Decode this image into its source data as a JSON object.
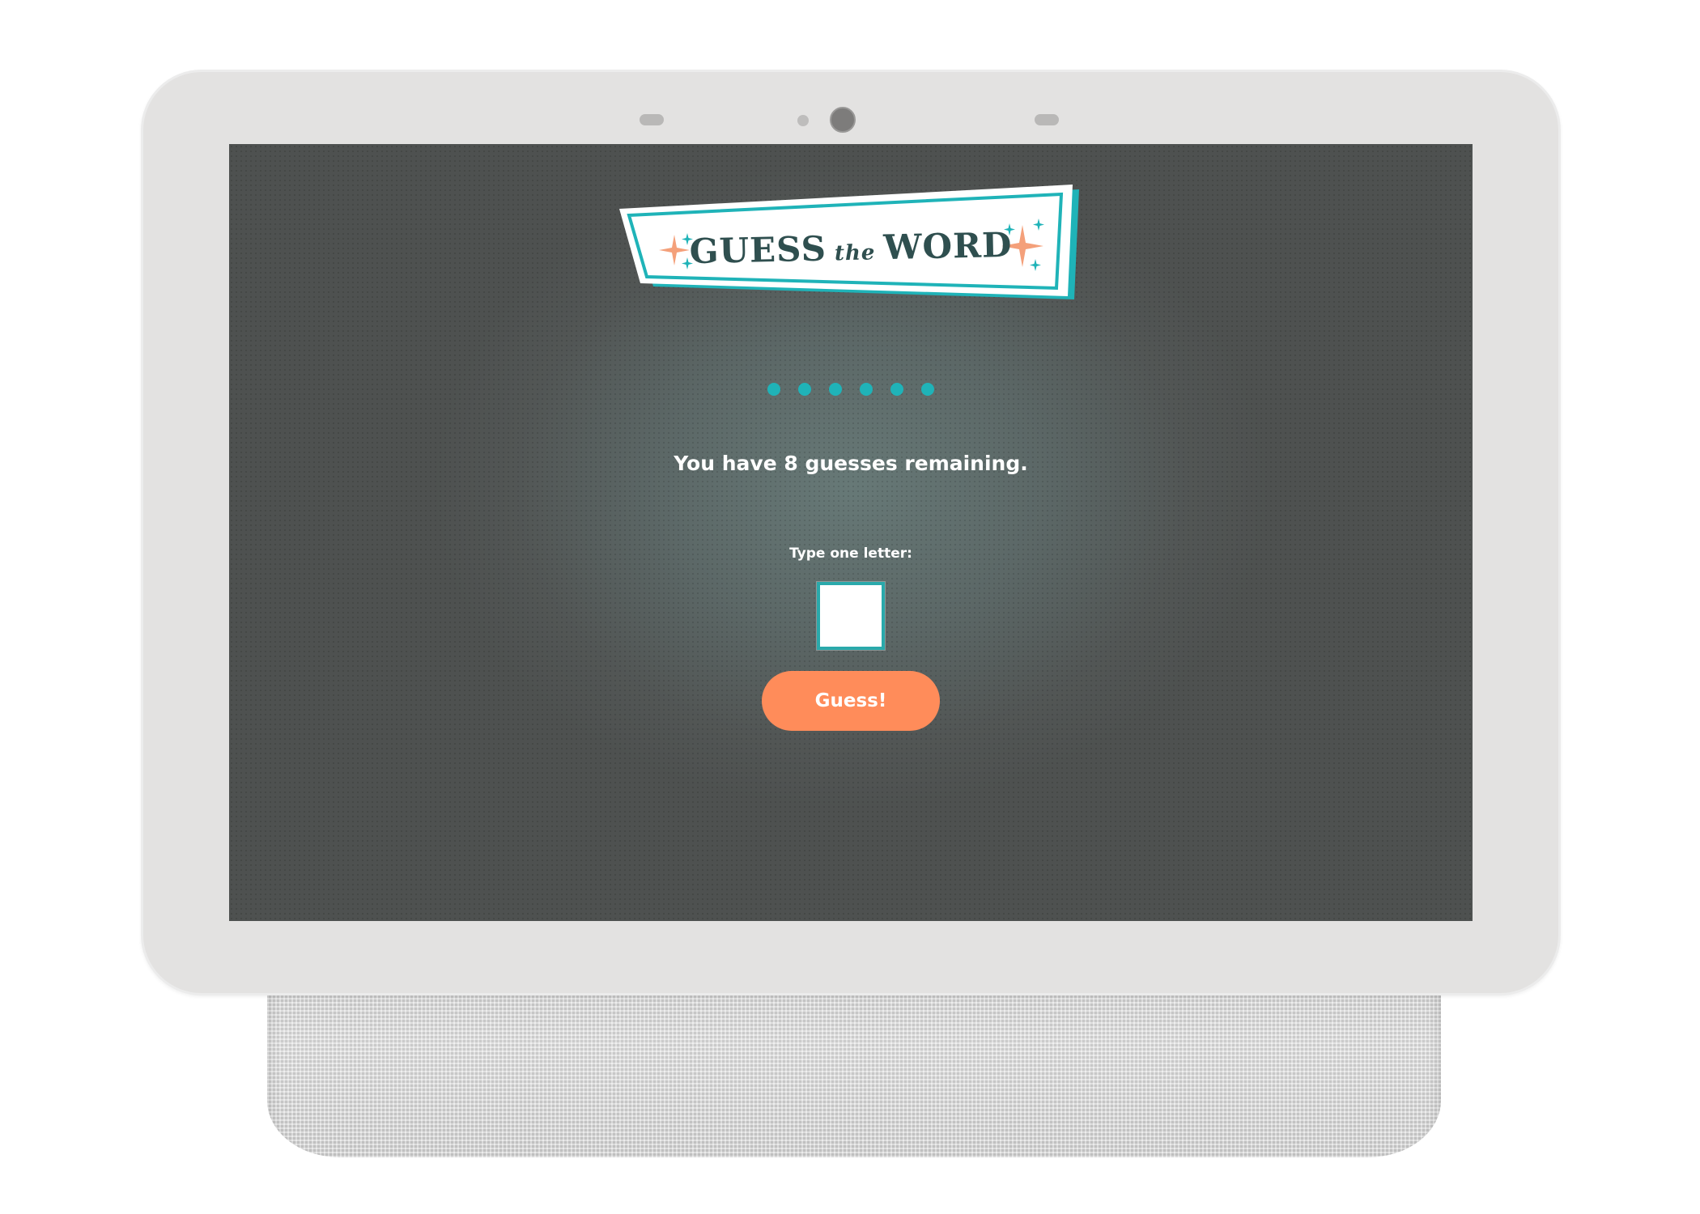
{
  "game": {
    "logo": {
      "word1": "GUESS",
      "word2": "the",
      "word3": "WORD"
    },
    "hidden_letter_count": 6,
    "status_text": "You have 8 guesses remaining.",
    "input_label": "Type one letter:",
    "input_value": "",
    "guess_button_label": "Guess!"
  },
  "colors": {
    "accent_teal": "#1fb3b8",
    "button_orange": "#ff8c5a",
    "logo_text": "#2f4f4f",
    "sparkle_orange": "#f4a07a"
  },
  "icons": [
    "sparkle-icon",
    "sparkle-icon",
    "sparkle-icon",
    "sparkle-icon",
    "sparkle-icon",
    "sparkle-icon"
  ]
}
